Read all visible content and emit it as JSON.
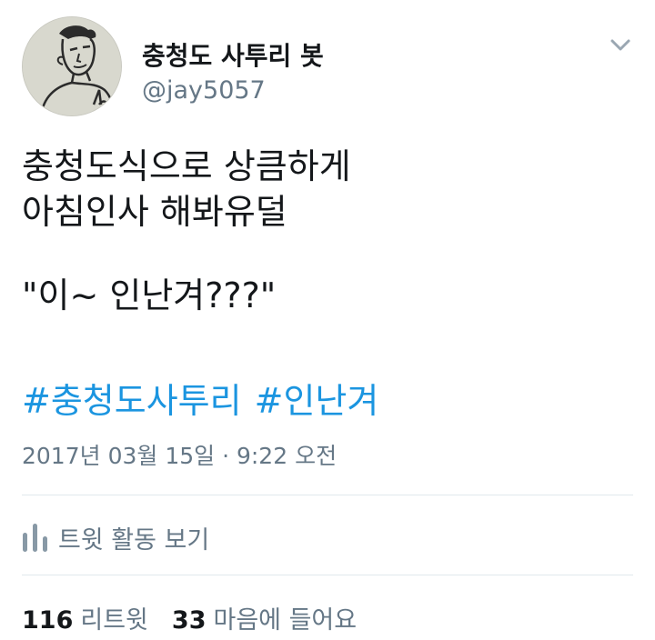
{
  "user": {
    "display_name": "충청도 사투리 봇",
    "handle": "@jay5057",
    "avatar_icon": "cartoon-man-avatar"
  },
  "menu_icon": "chevron-down-icon",
  "tweet": {
    "lines": [
      "충청도식으로 상큼하게",
      "아침인사 해봐유덜",
      "\"이~ 인난겨???\""
    ],
    "hashtags": [
      "#충청도사투리",
      "#인난겨"
    ],
    "timestamp": "2017년 03월 15일 · 9:22 오전"
  },
  "activity": {
    "icon": "bar-chart-icon",
    "label": "트윗 활동 보기"
  },
  "stats": {
    "retweets_count": "116",
    "retweets_label": "리트윗",
    "likes_count": "33",
    "likes_label": "마음에 들어요"
  },
  "colors": {
    "link": "#1b95e0",
    "secondary_text": "#657786",
    "divider": "#e1e8ed"
  }
}
